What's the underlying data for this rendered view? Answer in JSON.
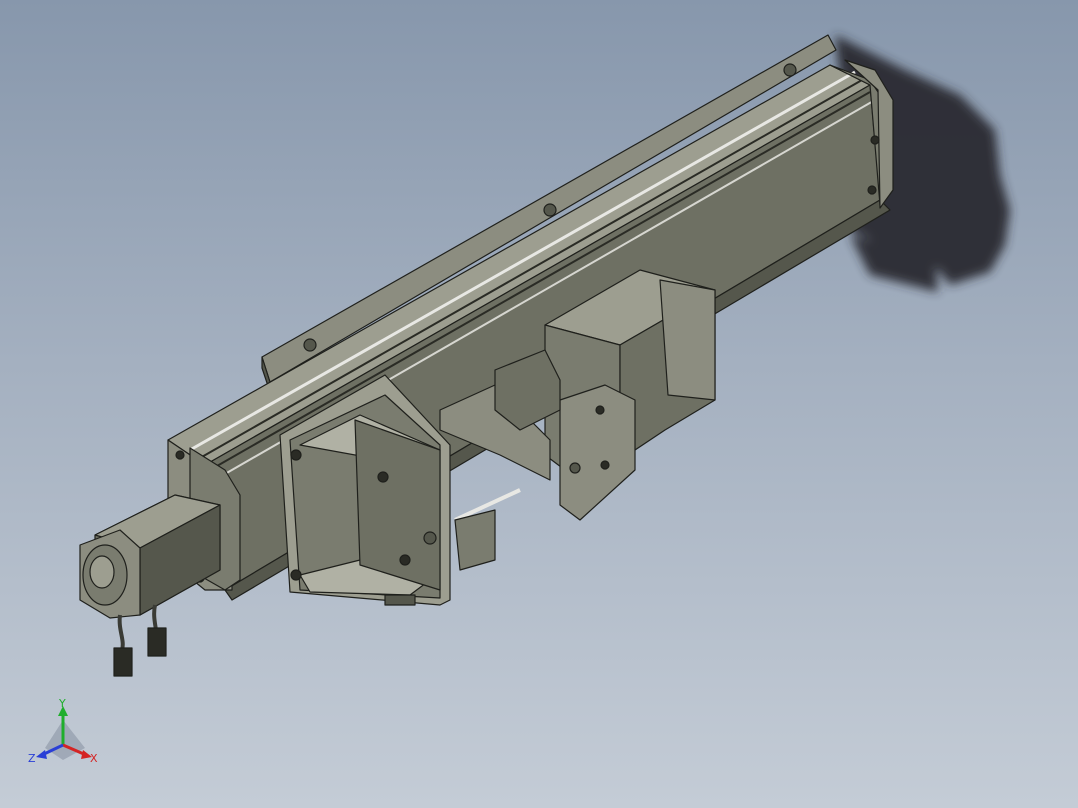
{
  "scene": {
    "colors": {
      "background_top": "#8797ac",
      "background_bottom": "#c4ccd6",
      "body_top": "#9d9e90",
      "body_side": "#6e7063",
      "body_front": "#55574c",
      "edge": "#1f201c",
      "shadow": "#2a2c30",
      "rail_highlight": "#e8e8e4"
    }
  },
  "triad": {
    "y_label": "Y",
    "x_label": "X",
    "z_label": "Z",
    "y_color": "#1fae2c",
    "x_color": "#d42424",
    "z_color": "#2a3fd6"
  }
}
